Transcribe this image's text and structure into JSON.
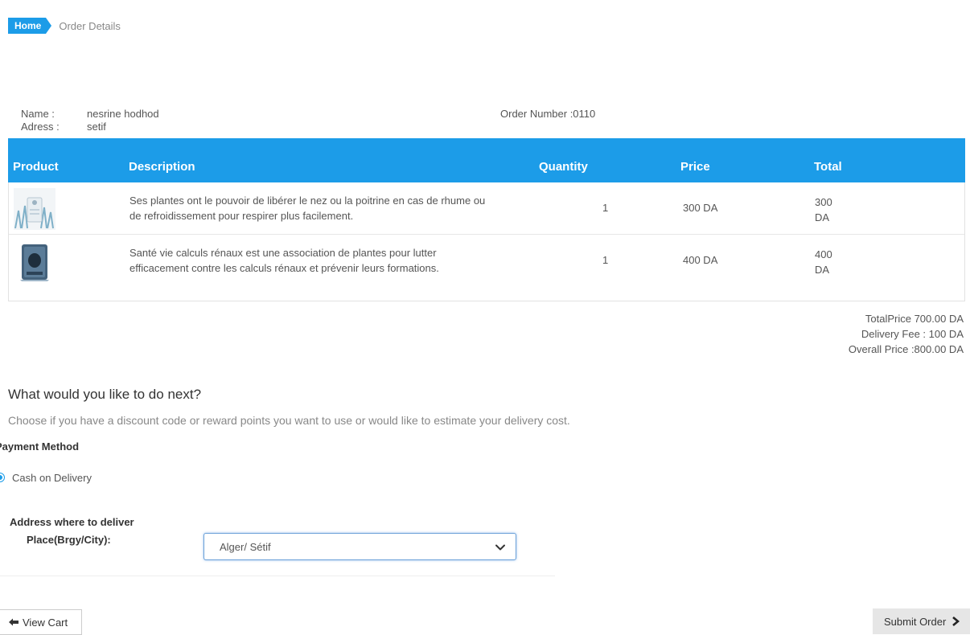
{
  "breadcrumb": {
    "home": "Home",
    "current": "Order Details"
  },
  "customer": {
    "name_label": "Name :",
    "name_value": "nesrine hodhod",
    "address_label": "Adress :",
    "address_value": "setif",
    "order_number": "Order Number :0110"
  },
  "table": {
    "headers": [
      "Product",
      "Description",
      "Quantity",
      "Price",
      "Total"
    ],
    "rows": [
      {
        "description_line1": "Ses plantes ont le pouvoir de libérer le nez ou la poitrine en cas de rhume ou",
        "description_line2": "de refroidissement pour respirer plus facilement.",
        "quantity": "1",
        "price": "300 DA",
        "total_line1": "300",
        "total_line2": "DA"
      },
      {
        "description_line1": "Santé vie calculs rénaux est une association de plantes pour lutter",
        "description_line2": "efficacement contre les calculs rénaux et prévenir leurs formations.",
        "quantity": "1",
        "price": "400 DA",
        "total_line1": "400",
        "total_line2": "DA"
      }
    ]
  },
  "totals": {
    "total_price": "TotalPrice 700.00 DA",
    "delivery_fee": "Delivery Fee : 100 DA",
    "overall_price": "Overall Price :800.00 DA"
  },
  "next": {
    "title": "What would you like to do next?",
    "text": "Choose if you have a discount code or reward points you want to use or would like to estimate your delivery cost."
  },
  "payment": {
    "title": "Payment Method",
    "option": "Cash on Delivery"
  },
  "delivery": {
    "title": "Address where to deliver",
    "place_label": "Place(Brgy/City):",
    "selected": "Alger/ Sétif"
  },
  "buttons": {
    "view_cart": "View Cart",
    "submit_order": "Submit Order"
  },
  "colors": {
    "accent": "#1c9ce8"
  }
}
